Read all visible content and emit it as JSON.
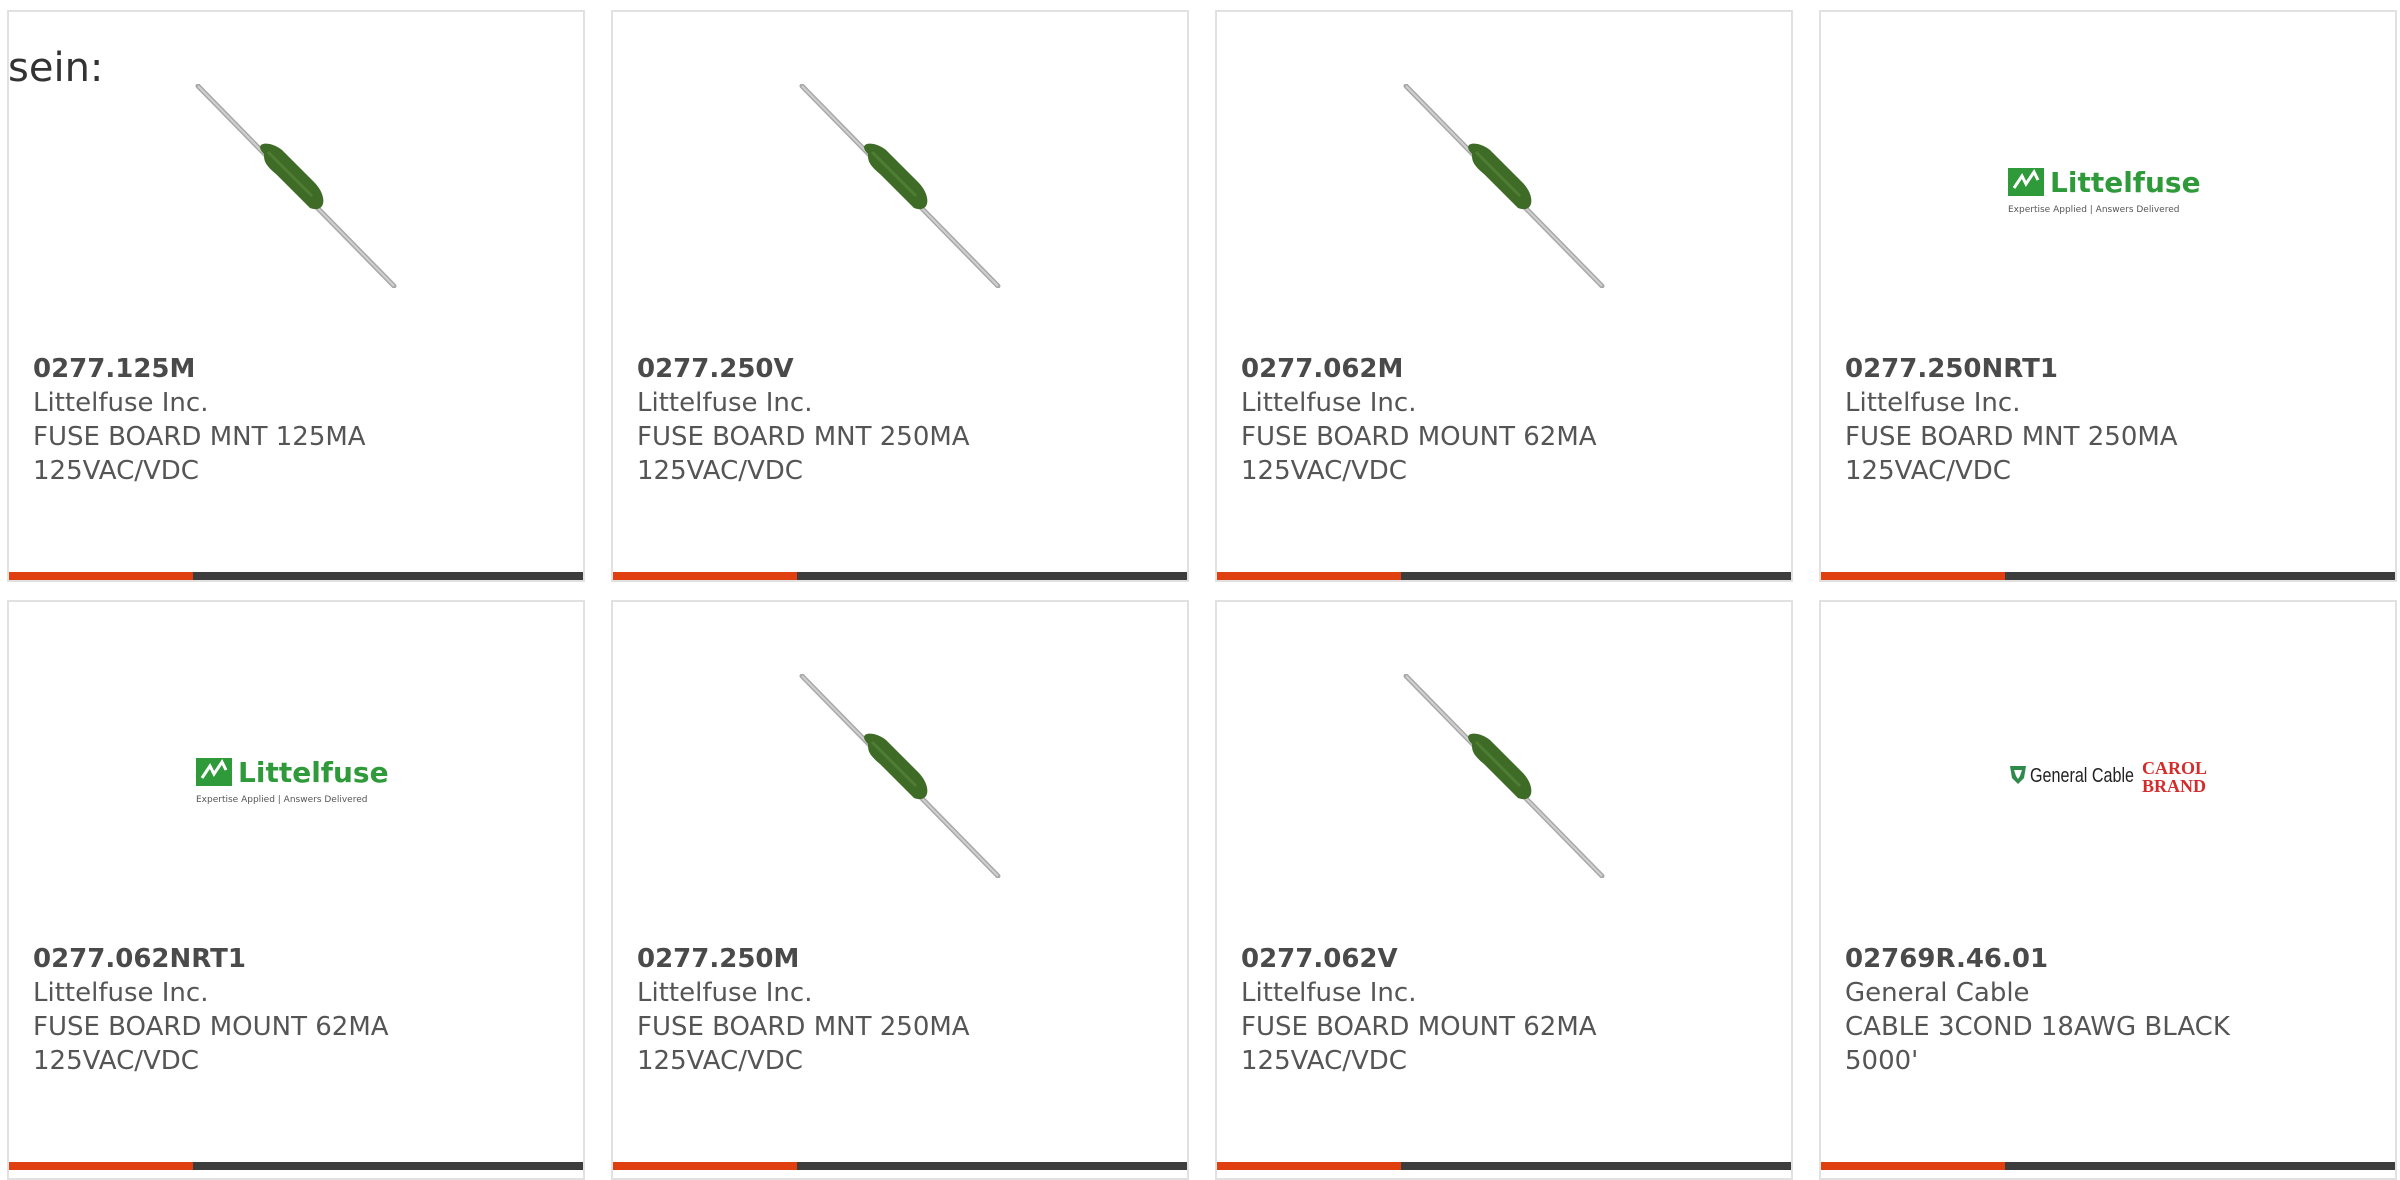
{
  "intro_text": "sein:",
  "colors": {
    "accent": "#e04010",
    "bar_dark": "#3d3d3d",
    "fuse_body": "#3e6b25",
    "littelfuse_green": "#2e9a3a",
    "general_cable_red": "#d42b2b"
  },
  "cards": [
    {
      "part_number": "0277.125M",
      "manufacturer": "Littelfuse Inc.",
      "desc1": "FUSE BOARD MNT 125MA",
      "desc2": "125VAC/VDC",
      "image": "fuse-image"
    },
    {
      "part_number": "0277.250V",
      "manufacturer": "Littelfuse Inc.",
      "desc1": "FUSE BOARD MNT 250MA",
      "desc2": "125VAC/VDC",
      "image": "fuse-image"
    },
    {
      "part_number": "0277.062M",
      "manufacturer": "Littelfuse Inc.",
      "desc1": "FUSE BOARD MOUNT 62MA",
      "desc2": "125VAC/VDC",
      "image": "fuse-image"
    },
    {
      "part_number": "0277.250NRT1",
      "manufacturer": "Littelfuse Inc.",
      "desc1": "FUSE BOARD MNT 250MA",
      "desc2": "125VAC/VDC",
      "image": "littelfuse-logo"
    },
    {
      "part_number": "0277.062NRT1",
      "manufacturer": "Littelfuse Inc.",
      "desc1": "FUSE BOARD MOUNT 62MA",
      "desc2": "125VAC/VDC",
      "image": "littelfuse-logo"
    },
    {
      "part_number": "0277.250M",
      "manufacturer": "Littelfuse Inc.",
      "desc1": "FUSE BOARD MNT 250MA",
      "desc2": "125VAC/VDC",
      "image": "fuse-image"
    },
    {
      "part_number": "0277.062V",
      "manufacturer": "Littelfuse Inc.",
      "desc1": "FUSE BOARD MOUNT 62MA",
      "desc2": "125VAC/VDC",
      "image": "fuse-image"
    },
    {
      "part_number": "02769R.46.01",
      "manufacturer": "General Cable",
      "desc1": "CABLE 3COND 18AWG BLACK",
      "desc2": "5000'",
      "image": "general-cable-logo"
    }
  ],
  "logos": {
    "littelfuse_name": "Littelfuse",
    "littelfuse_tagline": "Expertise Applied | Answers Delivered",
    "general_cable_name": "General Cable",
    "carol_brand_line1": "CAROL",
    "carol_brand_line2": "BRAND"
  }
}
